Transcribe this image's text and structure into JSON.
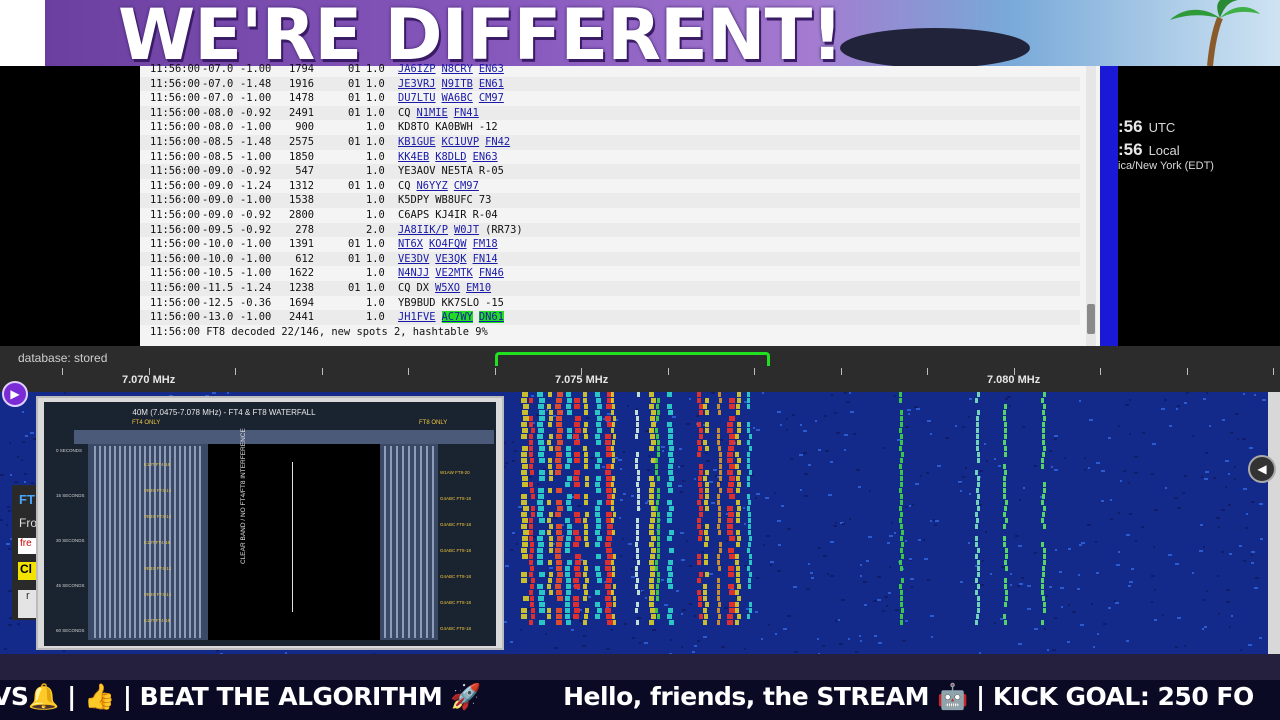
{
  "banner": {
    "title": "WE'RE DIFFERENT!"
  },
  "clock": {
    "utc_time": ":56",
    "utc_label": "UTC",
    "local_time": ":56",
    "local_label": "Local",
    "timezone": "ica/New York (EDT)"
  },
  "log": {
    "rows": [
      {
        "time": "11:56:00",
        "db": "-07.0",
        "dt": "-1.00",
        "freq": "1794",
        "s": "01",
        "q": "1.0",
        "parts": [
          {
            "t": "JA6IZP",
            "link": true
          },
          {
            "t": "N8CRY",
            "link": true
          },
          {
            "t": "EN63",
            "link": true
          }
        ]
      },
      {
        "time": "11:56:00",
        "db": "-07.0",
        "dt": "-1.48",
        "freq": "1916",
        "s": "01",
        "q": "1.0",
        "parts": [
          {
            "t": "JE3VRJ",
            "link": true
          },
          {
            "t": "N9ITB",
            "link": true
          },
          {
            "t": "EN61",
            "link": true
          }
        ]
      },
      {
        "time": "11:56:00",
        "db": "-07.0",
        "dt": "-1.00",
        "freq": "1478",
        "s": "01",
        "q": "1.0",
        "parts": [
          {
            "t": "DU7LTU",
            "link": true
          },
          {
            "t": "WA6BC",
            "link": true
          },
          {
            "t": "CM97",
            "link": true
          }
        ]
      },
      {
        "time": "11:56:00",
        "db": "-08.0",
        "dt": "-0.92",
        "freq": "2491",
        "s": "01",
        "q": "1.0",
        "parts": [
          {
            "t": "CQ",
            "link": false
          },
          {
            "t": "N1MIE",
            "link": true
          },
          {
            "t": "FN41",
            "link": true
          }
        ]
      },
      {
        "time": "11:56:00",
        "db": "-08.0",
        "dt": "-1.00",
        "freq": "900",
        "s": "",
        "q": "1.0",
        "parts": [
          {
            "t": "KD8TO",
            "link": false
          },
          {
            "t": "KA0BWH",
            "link": false
          },
          {
            "t": "-12",
            "link": false
          }
        ]
      },
      {
        "time": "11:56:00",
        "db": "-08.5",
        "dt": "-1.48",
        "freq": "2575",
        "s": "01",
        "q": "1.0",
        "parts": [
          {
            "t": "KB1GUE",
            "link": true
          },
          {
            "t": "KC1UVP",
            "link": true
          },
          {
            "t": "FN42",
            "link": true
          }
        ]
      },
      {
        "time": "11:56:00",
        "db": "-08.5",
        "dt": "-1.00",
        "freq": "1850",
        "s": "",
        "q": "1.0",
        "parts": [
          {
            "t": "KK4EB",
            "link": true
          },
          {
            "t": "K8DLD",
            "link": true
          },
          {
            "t": "EN63",
            "link": true
          }
        ]
      },
      {
        "time": "11:56:00",
        "db": "-09.0",
        "dt": "-0.92",
        "freq": "547",
        "s": "",
        "q": "1.0",
        "parts": [
          {
            "t": "YE3AOV",
            "link": false
          },
          {
            "t": "NE5TA",
            "link": false
          },
          {
            "t": "R-05",
            "link": false
          }
        ]
      },
      {
        "time": "11:56:00",
        "db": "-09.0",
        "dt": "-1.24",
        "freq": "1312",
        "s": "01",
        "q": "1.0",
        "parts": [
          {
            "t": "CQ",
            "link": false
          },
          {
            "t": "N6YYZ",
            "link": true
          },
          {
            "t": "CM97",
            "link": true
          }
        ]
      },
      {
        "time": "11:56:00",
        "db": "-09.0",
        "dt": "-1.00",
        "freq": "1538",
        "s": "",
        "q": "1.0",
        "parts": [
          {
            "t": "K5DPY",
            "link": false
          },
          {
            "t": "WB8UFC",
            "link": false
          },
          {
            "t": "73",
            "link": false
          }
        ]
      },
      {
        "time": "11:56:00",
        "db": "-09.0",
        "dt": "-0.92",
        "freq": "2800",
        "s": "",
        "q": "1.0",
        "parts": [
          {
            "t": "C6APS",
            "link": false
          },
          {
            "t": "KJ4IR",
            "link": false
          },
          {
            "t": "R-04",
            "link": false
          }
        ]
      },
      {
        "time": "11:56:00",
        "db": "-09.5",
        "dt": "-0.92",
        "freq": "278",
        "s": "",
        "q": "2.0",
        "parts": [
          {
            "t": "JA8IIK/P",
            "link": true
          },
          {
            "t": "W0JT",
            "link": true
          },
          {
            "t": "(RR73)",
            "link": false
          }
        ]
      },
      {
        "time": "11:56:00",
        "db": "-10.0",
        "dt": "-1.00",
        "freq": "1391",
        "s": "01",
        "q": "1.0",
        "parts": [
          {
            "t": "NT6X",
            "link": true
          },
          {
            "t": "KO4FQW",
            "link": true
          },
          {
            "t": "FM18",
            "link": true
          }
        ]
      },
      {
        "time": "11:56:00",
        "db": "-10.0",
        "dt": "-1.00",
        "freq": "612",
        "s": "01",
        "q": "1.0",
        "parts": [
          {
            "t": "VE3DV",
            "link": true
          },
          {
            "t": "VE3QK",
            "link": true
          },
          {
            "t": "FN14",
            "link": true
          }
        ]
      },
      {
        "time": "11:56:00",
        "db": "-10.5",
        "dt": "-1.00",
        "freq": "1622",
        "s": "",
        "q": "1.0",
        "parts": [
          {
            "t": "N4NJJ",
            "link": true
          },
          {
            "t": "VE2MTK",
            "link": true
          },
          {
            "t": "FN46",
            "link": true
          }
        ]
      },
      {
        "time": "11:56:00",
        "db": "-11.5",
        "dt": "-1.24",
        "freq": "1238",
        "s": "01",
        "q": "1.0",
        "parts": [
          {
            "t": "CQ",
            "link": false
          },
          {
            "t": "DX",
            "link": false
          },
          {
            "t": "W5XO",
            "link": true
          },
          {
            "t": "EM10",
            "link": true
          }
        ]
      },
      {
        "time": "11:56:00",
        "db": "-12.5",
        "dt": "-0.36",
        "freq": "1694",
        "s": "",
        "q": "1.0",
        "parts": [
          {
            "t": "YB9BUD",
            "link": false
          },
          {
            "t": "KK7SLO",
            "link": false
          },
          {
            "t": "-15",
            "link": false
          }
        ]
      },
      {
        "time": "11:56:00",
        "db": "-13.0",
        "dt": "-1.00",
        "freq": "2441",
        "s": "",
        "q": "1.0",
        "parts": [
          {
            "t": "JH1FVE",
            "link": true
          },
          {
            "t": "AC7WY",
            "link": true,
            "hl": true
          },
          {
            "t": "DN61",
            "link": true,
            "hl": true
          }
        ]
      }
    ],
    "summary": "11:56:00 FT8 decoded 22/146, new spots 2, hashtable 9%"
  },
  "scale": {
    "status": "database: stored",
    "labels": [
      "7.070 MHz",
      "7.075 MHz",
      "7.080 MHz"
    ],
    "passband_label": ""
  },
  "side_panel": {
    "ft": "FT",
    "from": "Fro",
    "freq": "fre",
    "clear": "Cl",
    "r": "r"
  },
  "reference_image": {
    "title": "40M (7.0475-7.078 MHz) - FT4 & FT8 WATERFALL",
    "ft4_label": "FT4 ONLY",
    "ft8_label": "FT8 ONLY",
    "clear_band": "CLEAR BAND / NO FT4/FT8 INTERFERENCE",
    "y_labels": [
      "0 SECONDS",
      "15 SECONDS",
      "30 SECONDS",
      "45 SECONDS",
      "60 SECONDS"
    ],
    "spots_left": [
      "K1JT FT4-16",
      "VE3X FT4-12",
      "VE3X FT4-12",
      "K1JT FT4-16",
      "VE3X FT4-12",
      "VE3X FT4-12",
      "K1JT FT4-16"
    ],
    "spots_right": [
      "W1AW FT8-20",
      "G4ABC FT8-18",
      "G4ABC FT8-18",
      "G4ABC FT8-18",
      "G4ABC FT8-18",
      "G4ABC FT8-18",
      "G4ABC FT8-18"
    ]
  },
  "ticker": {
    "text": "VS🔔 | 👍 | BEAT THE ALGORITHM 🚀          Hello, friends, the STREAM 🤖 | KICK GOAL: 250 FO"
  },
  "colors": {
    "passband": "#20e020",
    "highlight": "#22dd22",
    "link": "#1a1aa8",
    "waterfall_bg": "#142a8a"
  }
}
